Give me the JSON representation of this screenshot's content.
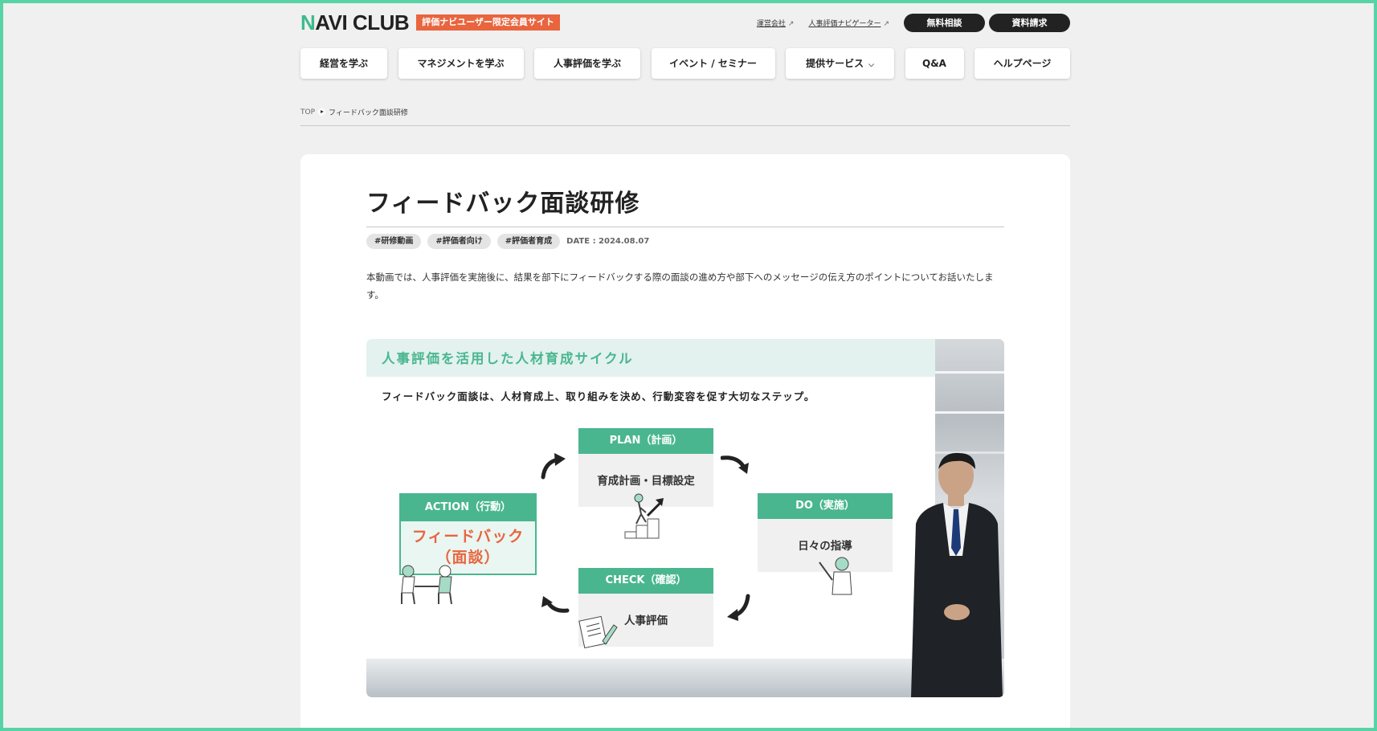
{
  "header": {
    "logo_first": "N",
    "logo_rest": "AVI CLUB",
    "member_badge": "評価ナビユーザー限定会員サイト",
    "links": [
      "運営会社",
      "人事評価ナビゲーター"
    ],
    "buttons": {
      "consult": "無料相談",
      "request": "資料請求"
    }
  },
  "nav": {
    "items": [
      "経営を学ぶ",
      "マネジメントを学ぶ",
      "人事評価を学ぶ",
      "イベント / セミナー",
      "提供サービス",
      "Q&A",
      "ヘルプページ"
    ]
  },
  "breadcrumb": {
    "home": "TOP",
    "current": "フィードバック面談研修"
  },
  "article": {
    "title": "フィードバック面談研修",
    "tags": [
      "#研修動画",
      "#評価者向け",
      "#評価者育成"
    ],
    "date": "DATE : 2024.08.07",
    "description": "本動画では、人事評価を実施後に、結果を部下にフィードバックする際の面談の進め方や部下へのメッセージの伝え方のポイントについてお話いたします。"
  },
  "slide": {
    "title": "人事評価を活用した人材育成サイクル",
    "subtitle": "フィードバック面談は、人材育成上、取り組みを決め、行動変容を促す大切なステップ。",
    "plan": {
      "header": "PLAN（計画）",
      "body": "育成計画・目標設定"
    },
    "do": {
      "header": "DO（実施）",
      "body": "日々の指導"
    },
    "check": {
      "header": "CHECK（確認）",
      "body": "人事評価"
    },
    "action": {
      "header": "ACTION（行動）",
      "body_line1": "フィードバック",
      "body_line2": "（面談）"
    }
  },
  "colors": {
    "accent": "#4ab690",
    "badge": "#e8653e",
    "frame": "#57d3a6"
  }
}
